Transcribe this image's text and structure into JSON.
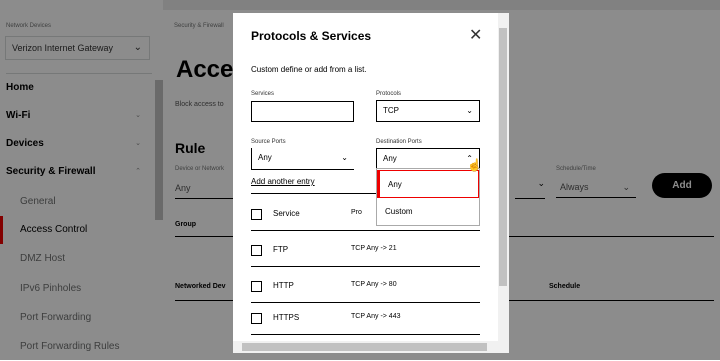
{
  "sidebar": {
    "network_devices_label": "Network Devices",
    "device_select": "Verizon Internet Gateway",
    "items": [
      {
        "label": "Home",
        "kind": "bold"
      },
      {
        "label": "Wi-Fi",
        "kind": "bold",
        "arrow": "⌄"
      },
      {
        "label": "Devices",
        "kind": "bold",
        "arrow": "⌄"
      },
      {
        "label": "Security & Firewall",
        "kind": "bold",
        "arrow": "⌃"
      },
      {
        "label": "General",
        "kind": "sub"
      },
      {
        "label": "Access Control",
        "kind": "active"
      },
      {
        "label": "DMZ Host",
        "kind": "sub"
      },
      {
        "label": "IPv6 Pinholes",
        "kind": "sub"
      },
      {
        "label": "Port Forwarding",
        "kind": "sub"
      },
      {
        "label": "Port Forwarding Rules",
        "kind": "sub"
      }
    ]
  },
  "main": {
    "breadcrumb": "Security & Firewall",
    "page_title": "Acces",
    "block_text": "Block access to",
    "rule_title": "Rule",
    "device_label": "Device or Network",
    "device_value": "Any",
    "schedule_label": "Schedule/Time",
    "schedule_value": "Always",
    "add_button": "Add",
    "group_header": "Group",
    "networked_header": "Networked Dev",
    "schedule_header": "Schedule"
  },
  "modal": {
    "title": "Protocols & Services",
    "close_icon": "close-icon",
    "description": "Custom define or add from a list.",
    "services_label": "Services",
    "services_value": "",
    "protocols_label": "Protocols",
    "protocols_value": "TCP",
    "source_ports_label": "Source Ports",
    "source_ports_value": "Any",
    "destination_ports_label": "Destination Ports",
    "destination_ports_value": "Any",
    "add_entry": "Add another entry",
    "dropdown_options": [
      "Any",
      "Custom"
    ],
    "table_header": {
      "service": "Service",
      "protocol": "Pro"
    },
    "rows": [
      {
        "service": "FTP",
        "protocol": "TCP Any -> 21"
      },
      {
        "service": "HTTP",
        "protocol": "TCP Any -> 80"
      },
      {
        "service": "HTTPS",
        "protocol": "TCP Any -> 443"
      }
    ]
  },
  "colors": {
    "accent": "#ee0000",
    "overlay": "#000000"
  }
}
